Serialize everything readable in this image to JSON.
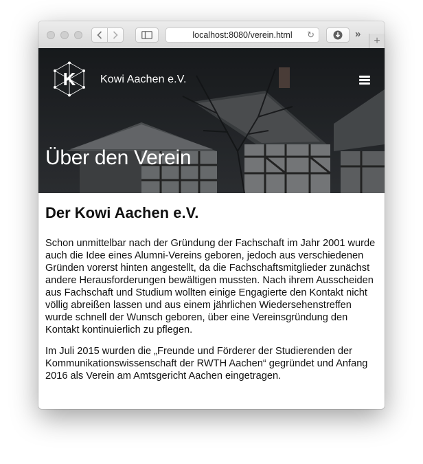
{
  "browser": {
    "address": "localhost:8080/verein.html",
    "icons": {
      "back": "chevron-left-icon",
      "forward": "chevron-right-icon",
      "sidebar": "sidebar-icon",
      "reload": "reload-icon",
      "download": "download-icon",
      "overflow": "chevron-double-right-icon",
      "new_tab": "plus-icon"
    },
    "reload_glyph": "↻",
    "overflow_glyph": "»",
    "new_tab_glyph": "+"
  },
  "header": {
    "logo_letter": "K",
    "brand": "Kowi Aachen e.V.",
    "menu_icon": "hamburger-menu-icon"
  },
  "hero": {
    "title": "Über den Verein"
  },
  "main": {
    "heading": "Der Kowi Aachen e.V.",
    "paragraphs": [
      "Schon unmittelbar nach der Gründung der Fachschaft im Jahr 2001 wurde auch die Idee eines Alumni-Vereins geboren, jedoch aus verschiedenen Gründen vorerst hinten angestellt, da die Fachschaftsmitglieder zunächst andere Herausforderungen bewältigen mussten. Nach ihrem Ausscheiden aus Fachschaft und Studium wollten einige Engagierte den Kontakt nicht völlig abreißen lassen und aus einem jährlichen Wiedersehenstreffen wurde schnell der Wunsch geboren, über eine Vereinsgründung den Kontakt kontinuierlich zu pflegen.",
      "Im Juli 2015 wurden die „Freunde und Förderer der Studierenden der Kommunikationswissenschaft der RWTH Aachen“ gegründet und Anfang 2016 als Verein am Amtsgericht Aachen eingetragen."
    ]
  },
  "colors": {
    "hero_overlay": "#2b2e32",
    "text": "#111111",
    "toolbar": "#e2e2e2"
  }
}
